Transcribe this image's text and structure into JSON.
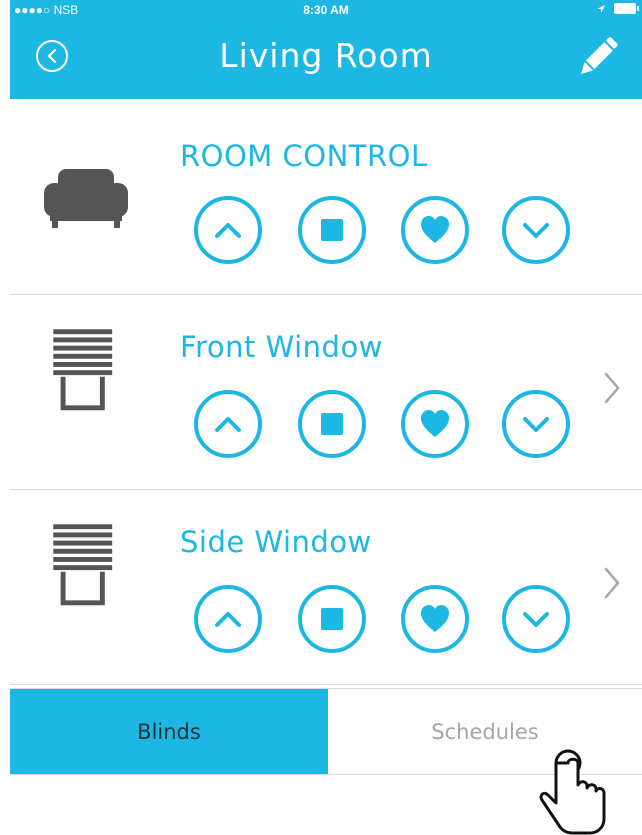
{
  "status": {
    "carrier": "●●●●○ NSB",
    "time": "8:30 AM"
  },
  "header": {
    "title": "Living Room"
  },
  "rows": [
    {
      "title": "ROOM CONTROL",
      "icon": "sofa-icon"
    },
    {
      "title": "Front Window",
      "icon": "blinds-icon"
    },
    {
      "title": "Side Window",
      "icon": "blinds-icon"
    }
  ],
  "tabs": {
    "blinds": "Blinds",
    "schedules": "Schedules"
  },
  "colors": {
    "accent": "#1cb8e3",
    "icon_gray": "#555555"
  }
}
